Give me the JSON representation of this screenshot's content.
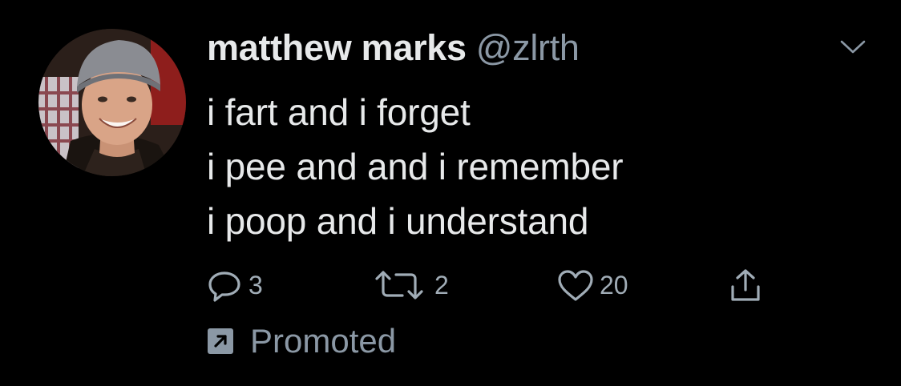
{
  "user": {
    "display_name": "matthew marks",
    "handle": "@zlrth"
  },
  "tweet": {
    "lines": [
      "i fart and i forget",
      "i pee and and i remember",
      "i poop and i understand"
    ]
  },
  "actions": {
    "reply_count": "3",
    "retweet_count": "2",
    "like_count": "20"
  },
  "promoted": {
    "label": "Promoted"
  },
  "icons": {
    "avatar": "avatar-photo",
    "menu": "chevron-down-icon",
    "reply": "reply-icon",
    "retweet": "retweet-icon",
    "like": "heart-icon",
    "share": "share-icon",
    "promoted": "promoted-arrow-icon"
  },
  "colors": {
    "background": "#000000",
    "primary_text": "#e7e9ea",
    "secondary_text": "#8b98a5",
    "icon": "#a0acb6"
  }
}
